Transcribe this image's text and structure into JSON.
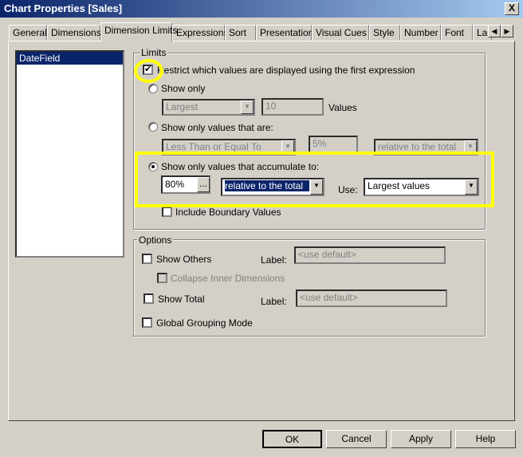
{
  "window": {
    "title": "Chart Properties [Sales]",
    "close": "X"
  },
  "tabs": [
    "General",
    "Dimensions",
    "Dimension Limits",
    "Expressions",
    "Sort",
    "Presentation",
    "Visual Cues",
    "Style",
    "Number",
    "Font",
    "La"
  ],
  "tab_scroll": {
    "left": "◀",
    "right": "▶"
  },
  "dimensions": [
    "DateField"
  ],
  "limits": {
    "group_label": "Limits",
    "restrict_label": "Restrict which values are displayed using the first expression",
    "restrict_checked": true,
    "show_only_label": "Show only",
    "show_only_select": "Largest",
    "show_only_count": "10",
    "values_label": "Values",
    "show_only_values_label": "Show only values that are:",
    "compare_select": "Less Than or Equal To",
    "compare_value": "5%",
    "compare_relative": "relative to the total",
    "accumulate_label": "Show only values that accumulate to:",
    "accumulate_value": "80%",
    "ellipsis": "...",
    "accumulate_relative": "relative to the total",
    "use_label": "Use:",
    "use_select": "Largest values",
    "include_boundary_label": "Include Boundary Values",
    "selected_radio": "accumulate"
  },
  "options": {
    "group_label": "Options",
    "show_others": "Show Others",
    "label1": "Label:",
    "label1_placeholder": "<use default>",
    "collapse_inner": "Collapse Inner Dimensions",
    "show_total": "Show Total",
    "label2": "Label:",
    "label2_placeholder": "<use default>",
    "global_grouping": "Global Grouping Mode"
  },
  "buttons": {
    "ok": "OK",
    "cancel": "Cancel",
    "apply": "Apply",
    "help": "Help"
  },
  "highlight_color": "#ffff00"
}
